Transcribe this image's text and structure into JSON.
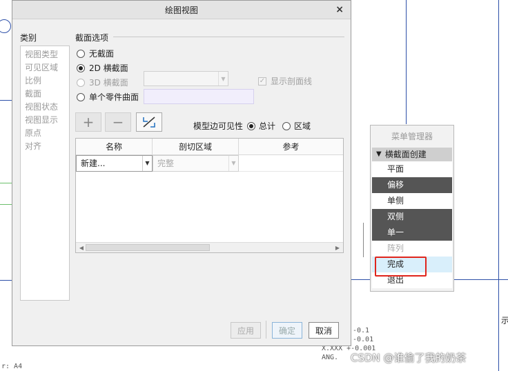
{
  "dialog": {
    "title": "绘图视图",
    "close_label": "×",
    "category_label": "类别",
    "categories": [
      "视图类型",
      "可见区域",
      "比例",
      "截面",
      "视图状态",
      "视图显示",
      "原点",
      "对齐"
    ],
    "section_title": "截面选项",
    "options": {
      "none": "无截面",
      "two_d": "2D 横截面",
      "three_d": "3D 横截面",
      "single_surface": "单个零件曲面"
    },
    "show_hatch_label": "显示剖面线",
    "toolbar": {
      "add_symbol": "+",
      "remove_symbol": "−",
      "flip_symbol": "↗"
    },
    "visibility": {
      "label": "模型边可见性",
      "total": "总计",
      "area": "区域"
    },
    "table": {
      "headers": [
        "名称",
        "剖切区域",
        "参考"
      ],
      "row": {
        "name": "新建...",
        "region": "完整"
      }
    },
    "buttons": {
      "apply": "应用",
      "ok": "确定",
      "cancel": "取消"
    }
  },
  "menu": {
    "title": "菜单管理器",
    "section": "横截面创建",
    "items": [
      "平面",
      "偏移",
      "单侧",
      "双侧",
      "单一",
      "阵列",
      "完成",
      "退出"
    ]
  },
  "background": {
    "tolerance_lines": [
      "-0.1",
      "-0.01",
      "X.XXX +-0.001"
    ],
    "ang_label": "ANG.",
    "sheet_label": "r: A4",
    "right_label": "示"
  },
  "watermark": "CSDN @谁偷了我的奶茶",
  "colors": {
    "accent_red": "#e0241b",
    "drawing_blue": "#2c4fa8",
    "menu_dark": "#555555",
    "highlight": "#d9effb"
  }
}
